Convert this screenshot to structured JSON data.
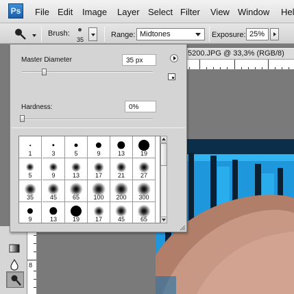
{
  "app": {
    "logo_text": "Ps"
  },
  "menu": [
    "File",
    "Edit",
    "Image",
    "Layer",
    "Select",
    "Filter",
    "View",
    "Window",
    "Hel"
  ],
  "options_bar": {
    "brush_label": "Brush:",
    "brush_size": "35",
    "range_label": "Range:",
    "range_value": "Midtones",
    "exposure_label": "Exposure:",
    "exposure_value": "25%"
  },
  "document": {
    "tab_title": "5200.JPG @ 33,3% (RGB/8)"
  },
  "brush_panel": {
    "master_diameter_label": "Master Diameter",
    "master_diameter_value": "35 px",
    "hardness_label": "Hardness:",
    "hardness_value": "0%",
    "presets": [
      {
        "size": "1",
        "blur": false
      },
      {
        "size": "3",
        "blur": false
      },
      {
        "size": "5",
        "blur": false
      },
      {
        "size": "9",
        "blur": false
      },
      {
        "size": "13",
        "blur": false
      },
      {
        "size": "19",
        "blur": false
      },
      {
        "size": "5",
        "blur": true
      },
      {
        "size": "9",
        "blur": true
      },
      {
        "size": "13",
        "blur": true
      },
      {
        "size": "17",
        "blur": true
      },
      {
        "size": "21",
        "blur": true
      },
      {
        "size": "27",
        "blur": true
      },
      {
        "size": "35",
        "blur": true
      },
      {
        "size": "45",
        "blur": true
      },
      {
        "size": "65",
        "blur": true
      },
      {
        "size": "100",
        "blur": true
      },
      {
        "size": "200",
        "blur": true
      },
      {
        "size": "300",
        "blur": true
      },
      {
        "size": "9",
        "blur": false
      },
      {
        "size": "13",
        "blur": false
      },
      {
        "size": "19",
        "blur": false
      },
      {
        "size": "17",
        "blur": true
      },
      {
        "size": "45",
        "blur": true
      },
      {
        "size": "65",
        "blur": true
      }
    ]
  },
  "tools": [
    "gradient-tool",
    "blur-tool",
    "dodge-tool"
  ],
  "ruler_numbers": {
    "left": "8"
  }
}
